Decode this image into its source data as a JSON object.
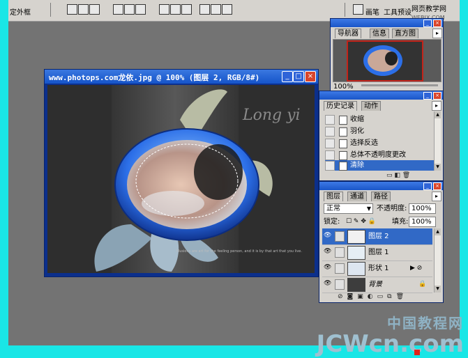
{
  "options_bar": {
    "left_text": "定外框",
    "right_tabs": [
      "画笔",
      "工具预设"
    ]
  },
  "site_watermark": {
    "line1": "网页教学网",
    "line2": "WEBJX.COM"
  },
  "document": {
    "title": "www.photops.com龙依.jpg @ 100% (图层 2, RGB/8#)",
    "canvas_script_text": "Long yi",
    "canvas_quote": "Illusions are art for the feeling person, and it is by that art that you live."
  },
  "navigator_panel": {
    "tabs": [
      "导航器",
      "信息",
      "直方图"
    ],
    "zoom": "100%"
  },
  "history_panel": {
    "tabs": [
      "历史记录",
      "动作"
    ],
    "items": [
      {
        "label": "收缩",
        "selected": false
      },
      {
        "label": "羽化",
        "selected": false
      },
      {
        "label": "选择反选",
        "selected": false
      },
      {
        "label": "总体不透明度更改",
        "selected": false
      },
      {
        "label": "清除",
        "selected": true
      }
    ]
  },
  "layers_panel": {
    "tabs": [
      "图层",
      "通道",
      "路径"
    ],
    "blend_mode": "正常",
    "opacity_label": "不透明度:",
    "opacity_value": "100%",
    "lock_label": "锁定:",
    "fill_label": "填充:",
    "fill_value": "100%",
    "layers": [
      {
        "name": "图层 2",
        "selected": true
      },
      {
        "name": "图层 1",
        "selected": false
      },
      {
        "name": "形状 1",
        "selected": false
      },
      {
        "name": "背景",
        "selected": false
      }
    ]
  },
  "bottom_watermark": {
    "cn": "中国教程网",
    "en": "JCWcn.com"
  },
  "colors": {
    "frame": "#19e6e6",
    "workspace": "#737373",
    "selection": "#3169c6",
    "titlebar": "#1554c9"
  }
}
